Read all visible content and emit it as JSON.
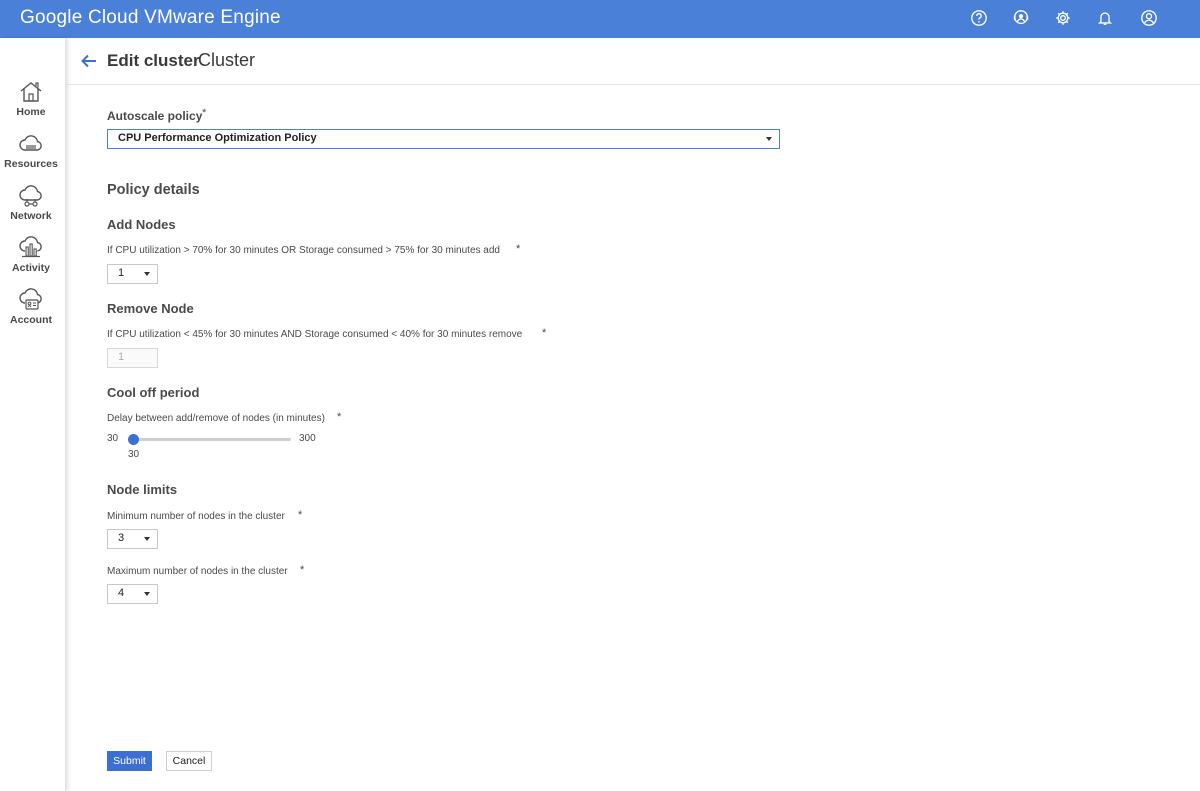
{
  "app": {
    "title": "Google Cloud VMware Engine"
  },
  "topbar_icons": [
    "help-icon",
    "support-icon",
    "settings-icon",
    "notifications-icon",
    "account-icon"
  ],
  "sidebar": {
    "items": [
      {
        "label": "Home",
        "icon": "home-icon"
      },
      {
        "label": "Resources",
        "icon": "cloud-icon"
      },
      {
        "label": "Network",
        "icon": "network-icon"
      },
      {
        "label": "Activity",
        "icon": "activity-icon"
      },
      {
        "label": "Account",
        "icon": "account-gear-icon"
      }
    ]
  },
  "header": {
    "title": "Edit cluster",
    "subtitle": "Cluster"
  },
  "form": {
    "autoscale_label": "Autoscale policy",
    "autoscale_value": "CPU Performance Optimization Policy",
    "required_mark": "*",
    "policy_details_heading": "Policy details",
    "add_nodes": {
      "heading": "Add Nodes",
      "description": "If CPU utilization > 70% for 30 minutes OR Storage consumed > 75% for 30 minutes add",
      "value": "1"
    },
    "remove_node": {
      "heading": "Remove Node",
      "description": "If CPU utilization < 45% for 30 minutes AND Storage consumed < 40% for 30 minutes remove",
      "value": "1"
    },
    "cool_off": {
      "heading": "Cool off period",
      "description": "Delay between add/remove of nodes (in minutes)",
      "min": "30",
      "max": "300",
      "current": "30"
    },
    "node_limits": {
      "heading": "Node limits",
      "min_label": "Minimum number of nodes in the cluster",
      "min_value": "3",
      "max_label": "Maximum number of nodes in the cluster",
      "max_value": "4"
    }
  },
  "actions": {
    "submit": "Submit",
    "cancel": "Cancel"
  },
  "colors": {
    "topbar": "#4a80d7",
    "primary": "#3b6fd1"
  }
}
